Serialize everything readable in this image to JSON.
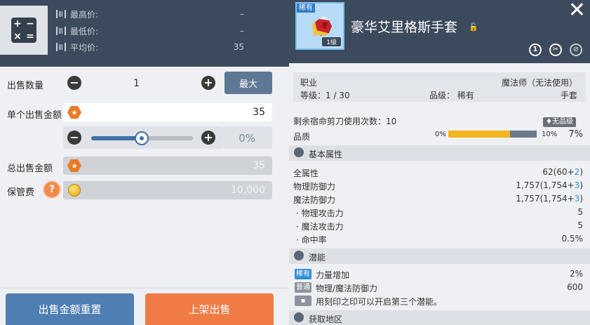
{
  "calc": {
    "symbols": [
      "+",
      "−",
      "×",
      "="
    ]
  },
  "prices": [
    {
      "label": "最高价:",
      "value": "–"
    },
    {
      "label": "最低价:",
      "value": "–"
    },
    {
      "label": "平均价:",
      "value": "35"
    }
  ],
  "sell": {
    "qty_label": "出售数量",
    "qty_value": "1",
    "max_label": "最大",
    "unit_price_label": "单个出售金额",
    "unit_price_value": "35",
    "slider_percent": 0,
    "slider_pct_text": "0%",
    "total_label": "总出售金额",
    "total_value": "35",
    "fee_label": "保管费",
    "fee_value": "10,000",
    "help_glyph": "?",
    "reset_label": "出售金额重置",
    "list_label": "上架出售"
  },
  "item": {
    "rarity_tag": "稀有",
    "level_tag": "1级",
    "name": "豪华艾里格斯手套",
    "job_label": "职业",
    "job_value": "魔法师（无法使用）",
    "level_text": "等级：1 / 30",
    "grade_text": "品级：  稀有",
    "slot_value": "手套",
    "scissors_text": "剩余宿命剪刀使用次数：10",
    "no_grade_hint": "♦无品级",
    "quality_label": "品质",
    "quality_min": "0%",
    "quality_max": "10%",
    "quality_value": "7%",
    "quality_fill": 0.7
  },
  "basic": {
    "title": "基本属性",
    "stats": [
      {
        "label": "全属性",
        "base": "62(60+",
        "bonus": "2",
        "end": ")"
      },
      {
        "label": "物理防御力",
        "base": "1,757(1,754+",
        "bonus": "3",
        "end": ")"
      },
      {
        "label": "魔法防御力",
        "base": "1,757(1,754+",
        "bonus": "3",
        "end": ")"
      }
    ],
    "sub_stats": [
      {
        "label": "·  物理攻击力",
        "value": "5"
      },
      {
        "label": "·  魔法攻击力",
        "value": "5"
      },
      {
        "label": "·  命中率",
        "value": "0.5%"
      }
    ]
  },
  "potential": {
    "title": "潜能",
    "lines": [
      {
        "tag": "稀有",
        "label": "力量增加",
        "value": "2%",
        "color": "#2f8fd6"
      },
      {
        "tag": "普通",
        "label": "物理/魔法防御力",
        "value": "600",
        "color": "#8c939c"
      }
    ],
    "note": "用刻印之印可以开启第三个潜能。"
  },
  "obtain": {
    "title": "获取地区"
  },
  "colors": {
    "accent": "#4f7fb2",
    "orange": "#f07b44",
    "header": "#3b4a5c"
  }
}
